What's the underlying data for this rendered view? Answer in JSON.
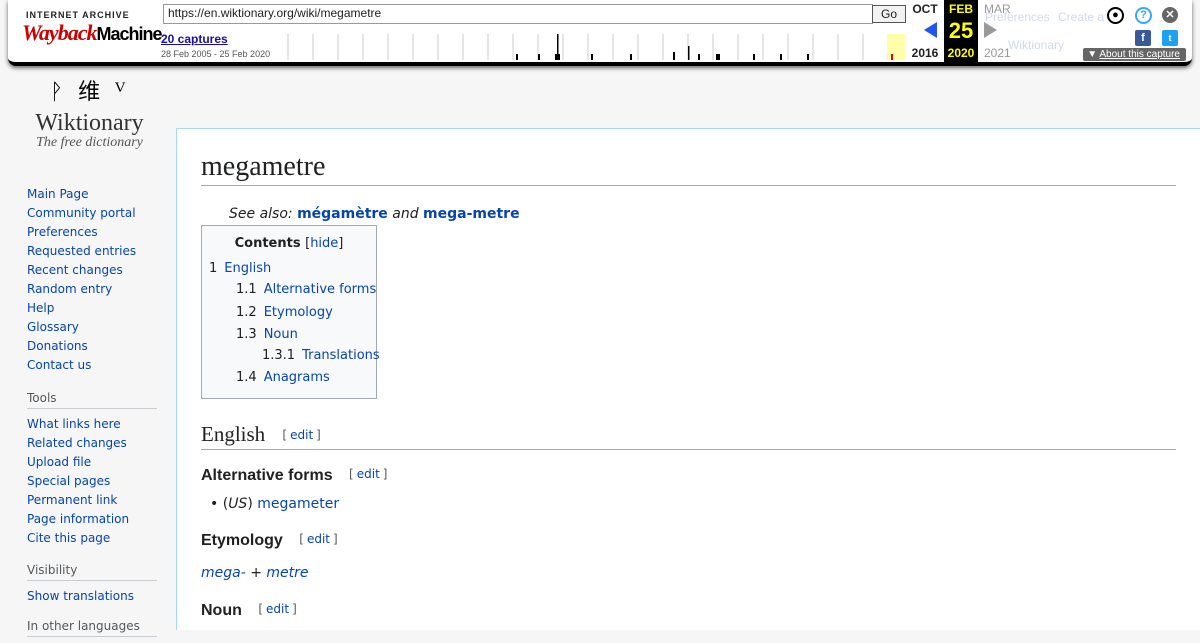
{
  "wayback": {
    "logo_top": "INTERNET ARCHIVE",
    "logo_main_red": "Wayback",
    "logo_main_black": "Machine",
    "url": "https://en.wiktionary.org/wiki/megametre",
    "go_label": "Go",
    "captures_label": "20 captures",
    "date_range": "28 Feb 2005 - 25 Feb 2020",
    "prev_month": "OCT",
    "prev_year": "2016",
    "cur_month": "FEB",
    "cur_day": "25",
    "cur_year": "2020",
    "next_month": "MAR",
    "next_year": "2021",
    "ghost_links": [
      "Preferences",
      "Create a",
      "Wiktionary"
    ],
    "about_label": "About this capture",
    "colors": {
      "accent_blue": "#2255ee",
      "current_bg": "#000000",
      "current_fg": "#ffff00",
      "highlight": "#ffffaa"
    }
  },
  "sidebar": {
    "logo_glyphs": "ᚹ 维 ⱽ",
    "logo_name": "Wiktionary",
    "logo_tagline": "The free dictionary",
    "nav": [
      "Main Page",
      "Community portal",
      "Preferences",
      "Requested entries",
      "Recent changes",
      "Random entry",
      "Help",
      "Glossary",
      "Donations",
      "Contact us"
    ],
    "tools_heading": "Tools",
    "tools": [
      "What links here",
      "Related changes",
      "Upload file",
      "Special pages",
      "Permanent link",
      "Page information",
      "Cite this page"
    ],
    "visibility_heading": "Visibility",
    "visibility": [
      "Show translations"
    ],
    "languages_heading": "In other languages"
  },
  "page": {
    "title": "megametre",
    "see_also_prefix": "See also:",
    "see_also_1": "mégamètre",
    "see_also_and": "and",
    "see_also_2": "mega-metre",
    "toc": {
      "title": "Contents",
      "hide": "hide",
      "items": [
        {
          "num": "1",
          "label": "English"
        },
        {
          "num": "1.1",
          "label": "Alternative forms"
        },
        {
          "num": "1.2",
          "label": "Etymology"
        },
        {
          "num": "1.3",
          "label": "Noun"
        },
        {
          "num": "1.3.1",
          "label": "Translations"
        },
        {
          "num": "1.4",
          "label": "Anagrams"
        }
      ]
    },
    "edit_label": "edit",
    "h_english": "English",
    "h_altforms": "Alternative forms",
    "alt_region": "US",
    "alt_link": "megameter",
    "h_etymology": "Etymology",
    "ety_part1": "mega-",
    "ety_plus": "+",
    "ety_part2": "metre",
    "h_noun": "Noun"
  }
}
